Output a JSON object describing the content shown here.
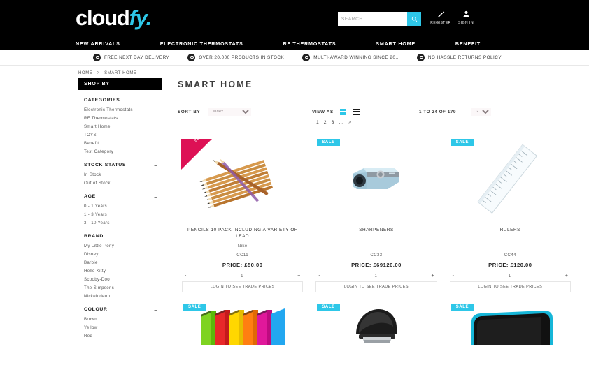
{
  "header": {
    "logo_primary": "cloud",
    "logo_accent": "fy.",
    "search_placeholder": "SEARCH",
    "search_value": "",
    "search_icon": "search-icon",
    "account": [
      {
        "label": "REGISTER",
        "icon": "pencil-edit-icon"
      },
      {
        "label": "SIGN IN",
        "icon": "user-person-icon"
      }
    ],
    "accent_color": "#2ec7e8",
    "bar_color": "#000000"
  },
  "nav": {
    "items": [
      {
        "label": "NEW ARRIVALS"
      },
      {
        "label": "ELECTRONIC THERMOSTATS"
      },
      {
        "label": "RF THERMOSTATS"
      },
      {
        "label": "SMART HOME"
      },
      {
        "label": "BENEFIT"
      }
    ]
  },
  "benefits": {
    "items": [
      {
        "icon": "location-pin-icon",
        "text": "FREE NEXT DAY DELIVERY"
      },
      {
        "icon": "location-pin-icon",
        "text": "OVER 20,000 PRODUCTS IN STOCK"
      },
      {
        "icon": "location-pin-icon",
        "text": "MULTI-AWARD WINNING SINCE 20.."
      },
      {
        "icon": "location-pin-icon",
        "text": "NO HASSLE RETURNS POLICY"
      }
    ]
  },
  "breadcrumb": {
    "home": "HOME",
    "separator": ">",
    "current": "SMART HOME"
  },
  "sidebar": {
    "title": "SHOP BY",
    "collapse_glyph": "–",
    "groups": [
      {
        "title": "CATEGORIES",
        "items": [
          {
            "label": "Electronic Thermostats"
          },
          {
            "label": "RF Thermostats"
          },
          {
            "label": "Smart Home"
          },
          {
            "label": "TOYS"
          },
          {
            "label": "Benefit"
          },
          {
            "label": "Test Category"
          }
        ]
      },
      {
        "title": "STOCK STATUS",
        "items": [
          {
            "label": "In Stock"
          },
          {
            "label": "Out of Stock"
          }
        ]
      },
      {
        "title": "AGE",
        "items": [
          {
            "label": "0 - 1 Years"
          },
          {
            "label": "1 - 3 Years"
          },
          {
            "label": "3 - 10 Years"
          }
        ]
      },
      {
        "title": "BRAND",
        "items": [
          {
            "label": "My Little Pony"
          },
          {
            "label": "Disney"
          },
          {
            "label": "Barbie"
          },
          {
            "label": "Hello Kitty"
          },
          {
            "label": "Scooby-Doo"
          },
          {
            "label": "The Simpsons"
          },
          {
            "label": "Nickelodeon"
          }
        ]
      },
      {
        "title": "COLOUR",
        "items": [
          {
            "label": "Brown"
          },
          {
            "label": "Yellow"
          },
          {
            "label": "Red"
          }
        ]
      }
    ]
  },
  "main": {
    "page_title": "SMART HOME",
    "toolbar": {
      "sort_label": "SORT BY",
      "sort_value": "Index",
      "view_label": "VIEW AS",
      "grid_icon": "grid-view-icon",
      "list_icon": "list-view-icon",
      "count_text": "1 TO 24 OF 179",
      "per_page_value": "24"
    },
    "pagination": {
      "pages": [
        "1",
        "2",
        "3",
        "…",
        ">"
      ]
    },
    "labels": {
      "price_prefix": "PRICE:",
      "trade_cta": "LOGIN TO SEE TRADE PRICES",
      "qty_minus": "-",
      "qty_plus": "+",
      "qty_value": "1",
      "sale_badge": "SALE",
      "bestseller_line1": "Best",
      "bestseller_line2": "Seller"
    },
    "products": [
      {
        "name": "PENCILS 10 PACK INCLUDING A VARIETY OF LEAD",
        "brand": "Nike",
        "sku": "CC11",
        "price": "PRICE: £50.00",
        "badge": "bestseller",
        "art": "pencils",
        "qty": "1"
      },
      {
        "name": "SHARPENERS",
        "brand": "",
        "sku": "CC33",
        "price": "PRICE: £69120.00",
        "badge": "sale",
        "art": "sharpener",
        "qty": "1"
      },
      {
        "name": "RULERS",
        "brand": "",
        "sku": "CC44",
        "price": "PRICE: £120.00",
        "badge": "sale",
        "art": "ruler",
        "qty": "1"
      },
      {
        "name": "",
        "brand": "",
        "sku": "",
        "price": "",
        "badge": "sale",
        "art": "folders",
        "qty": "1"
      },
      {
        "name": "",
        "brand": "",
        "sku": "",
        "price": "",
        "badge": "sale",
        "art": "stapler",
        "qty": "1"
      },
      {
        "name": "",
        "brand": "",
        "sku": "",
        "price": "",
        "badge": "sale",
        "art": "laptopcase",
        "qty": "1"
      }
    ]
  }
}
